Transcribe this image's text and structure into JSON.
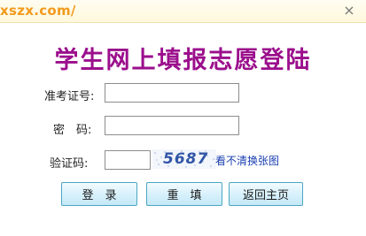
{
  "header": {
    "url_text": "xszx.com/",
    "close_symbol": "×"
  },
  "title": "学生网上填报志愿登陆",
  "form": {
    "exam_id_label": "准考证号:",
    "exam_id_value": "",
    "password_label": "密　码:",
    "password_value": "",
    "verify_label": "验证码:",
    "verify_value": "",
    "captcha_text": "5687",
    "refresh_link": "看不清换张图"
  },
  "buttons": {
    "login": "登　录",
    "reset": "重　填",
    "home": "返回主页"
  },
  "colors": {
    "title": "#9b0f8c",
    "url_text": "#f29a1c",
    "link": "#1a3fb0",
    "button_border": "#4ba7c3"
  }
}
